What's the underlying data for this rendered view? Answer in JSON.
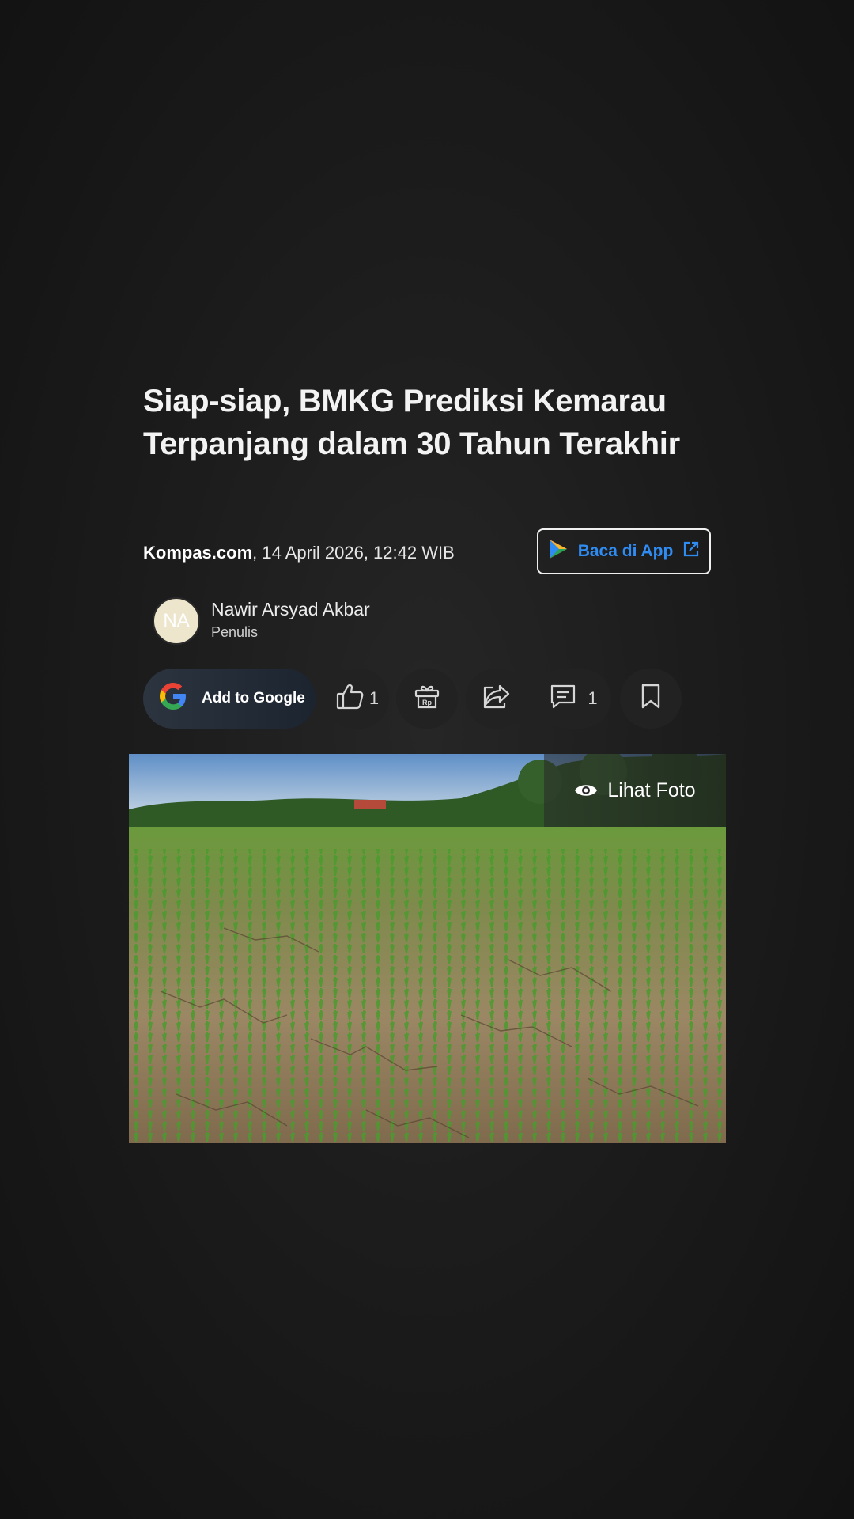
{
  "article": {
    "title": "Siap-siap, BMKG Prediksi Kemarau Terpanjang dalam 30 Tahun Terakhir",
    "source": "Kompas.com",
    "date": ", 14 April 2026, 12:42 WIB"
  },
  "app_button": {
    "label": "Baca di App",
    "icon": "play-store-icon",
    "accent": "#2f8cf3"
  },
  "author": {
    "initials": "NA",
    "name": "Nawir Arsyad Akbar",
    "role": "Penulis"
  },
  "actions": {
    "google_label": "Add to Google",
    "like_count": "1",
    "gift_label": "Rp",
    "comment_count": "1"
  },
  "photo": {
    "view_label": "Lihat Foto"
  }
}
